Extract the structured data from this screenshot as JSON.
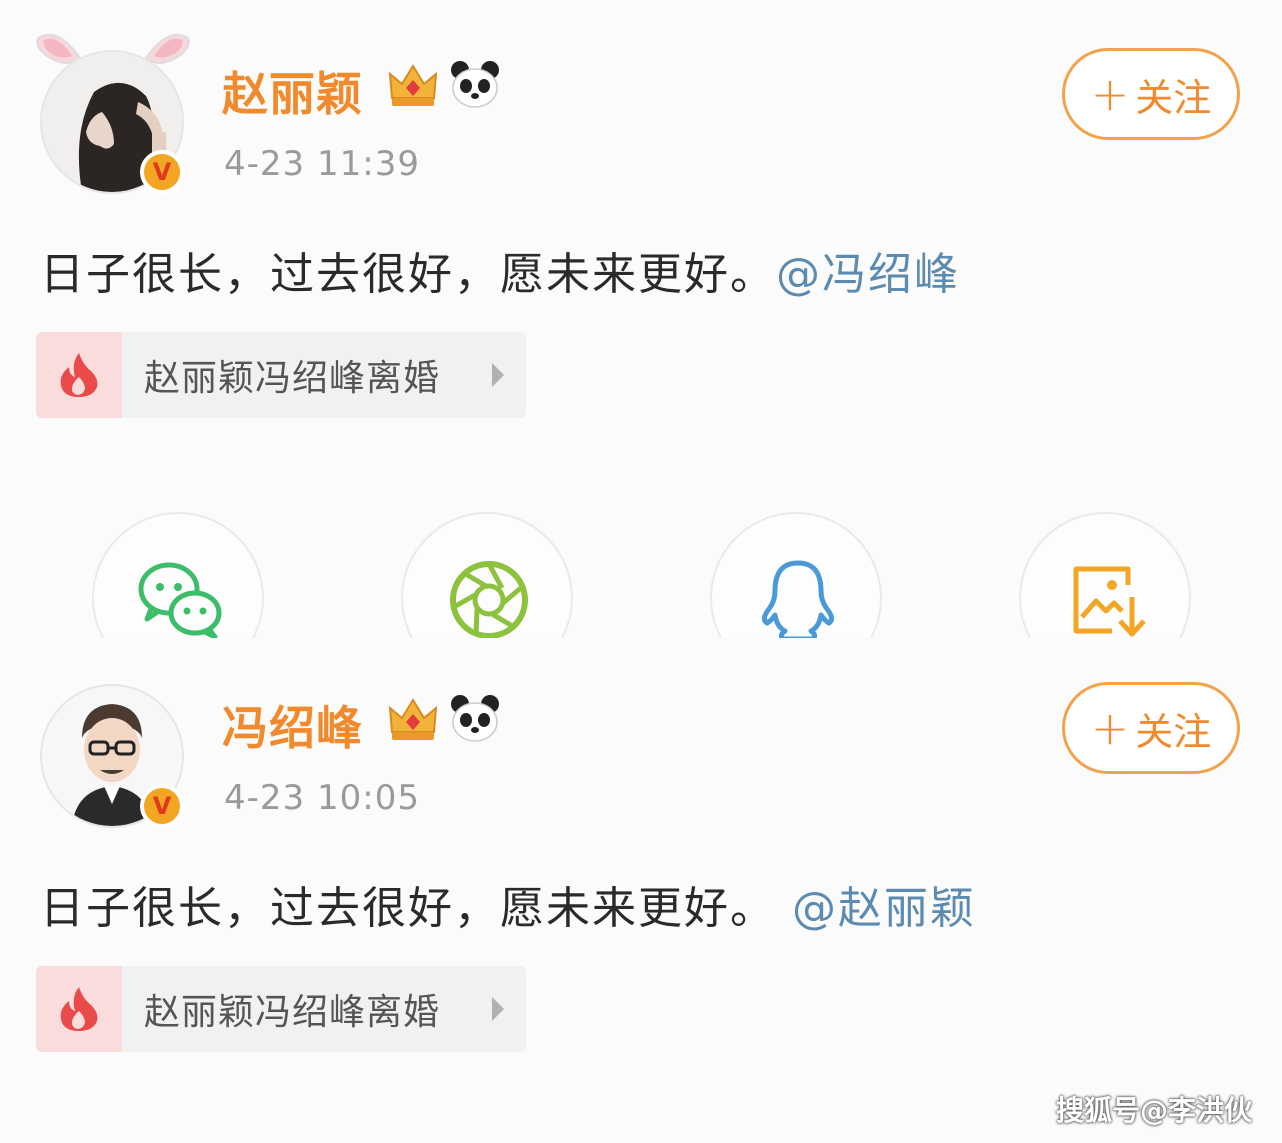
{
  "posts": [
    {
      "username": "赵丽颖",
      "timestamp": "4-23 11:39",
      "follow_label": "关注",
      "follow_plus": "+",
      "content_text": "日子很长，过去很好，愿未来更好。",
      "mention": "@冯绍峰",
      "topic": "赵丽颖冯绍峰离婚",
      "verified_mark": "V"
    },
    {
      "username": "冯绍峰",
      "timestamp": "4-23 10:05",
      "follow_label": "关注",
      "follow_plus": "+",
      "content_text": "日子很长，过去很好，愿未来更好。",
      "mention": "@赵丽颖",
      "topic": "赵丽颖冯绍峰离婚",
      "verified_mark": "V"
    }
  ],
  "share": {
    "items": [
      "wechat-icon",
      "moments-icon",
      "qq-icon",
      "save-image-icon"
    ]
  },
  "colors": {
    "username": "#f08a2c",
    "mention": "#5b8bb0",
    "timestamp": "#9a9a9a",
    "wechat": "#3dbd6a",
    "moments": "#8cc23d",
    "qq": "#4a9ad8",
    "save": "#f2a623",
    "fire": "#e94a4a"
  },
  "watermark": "搜狐号@李洪伙"
}
